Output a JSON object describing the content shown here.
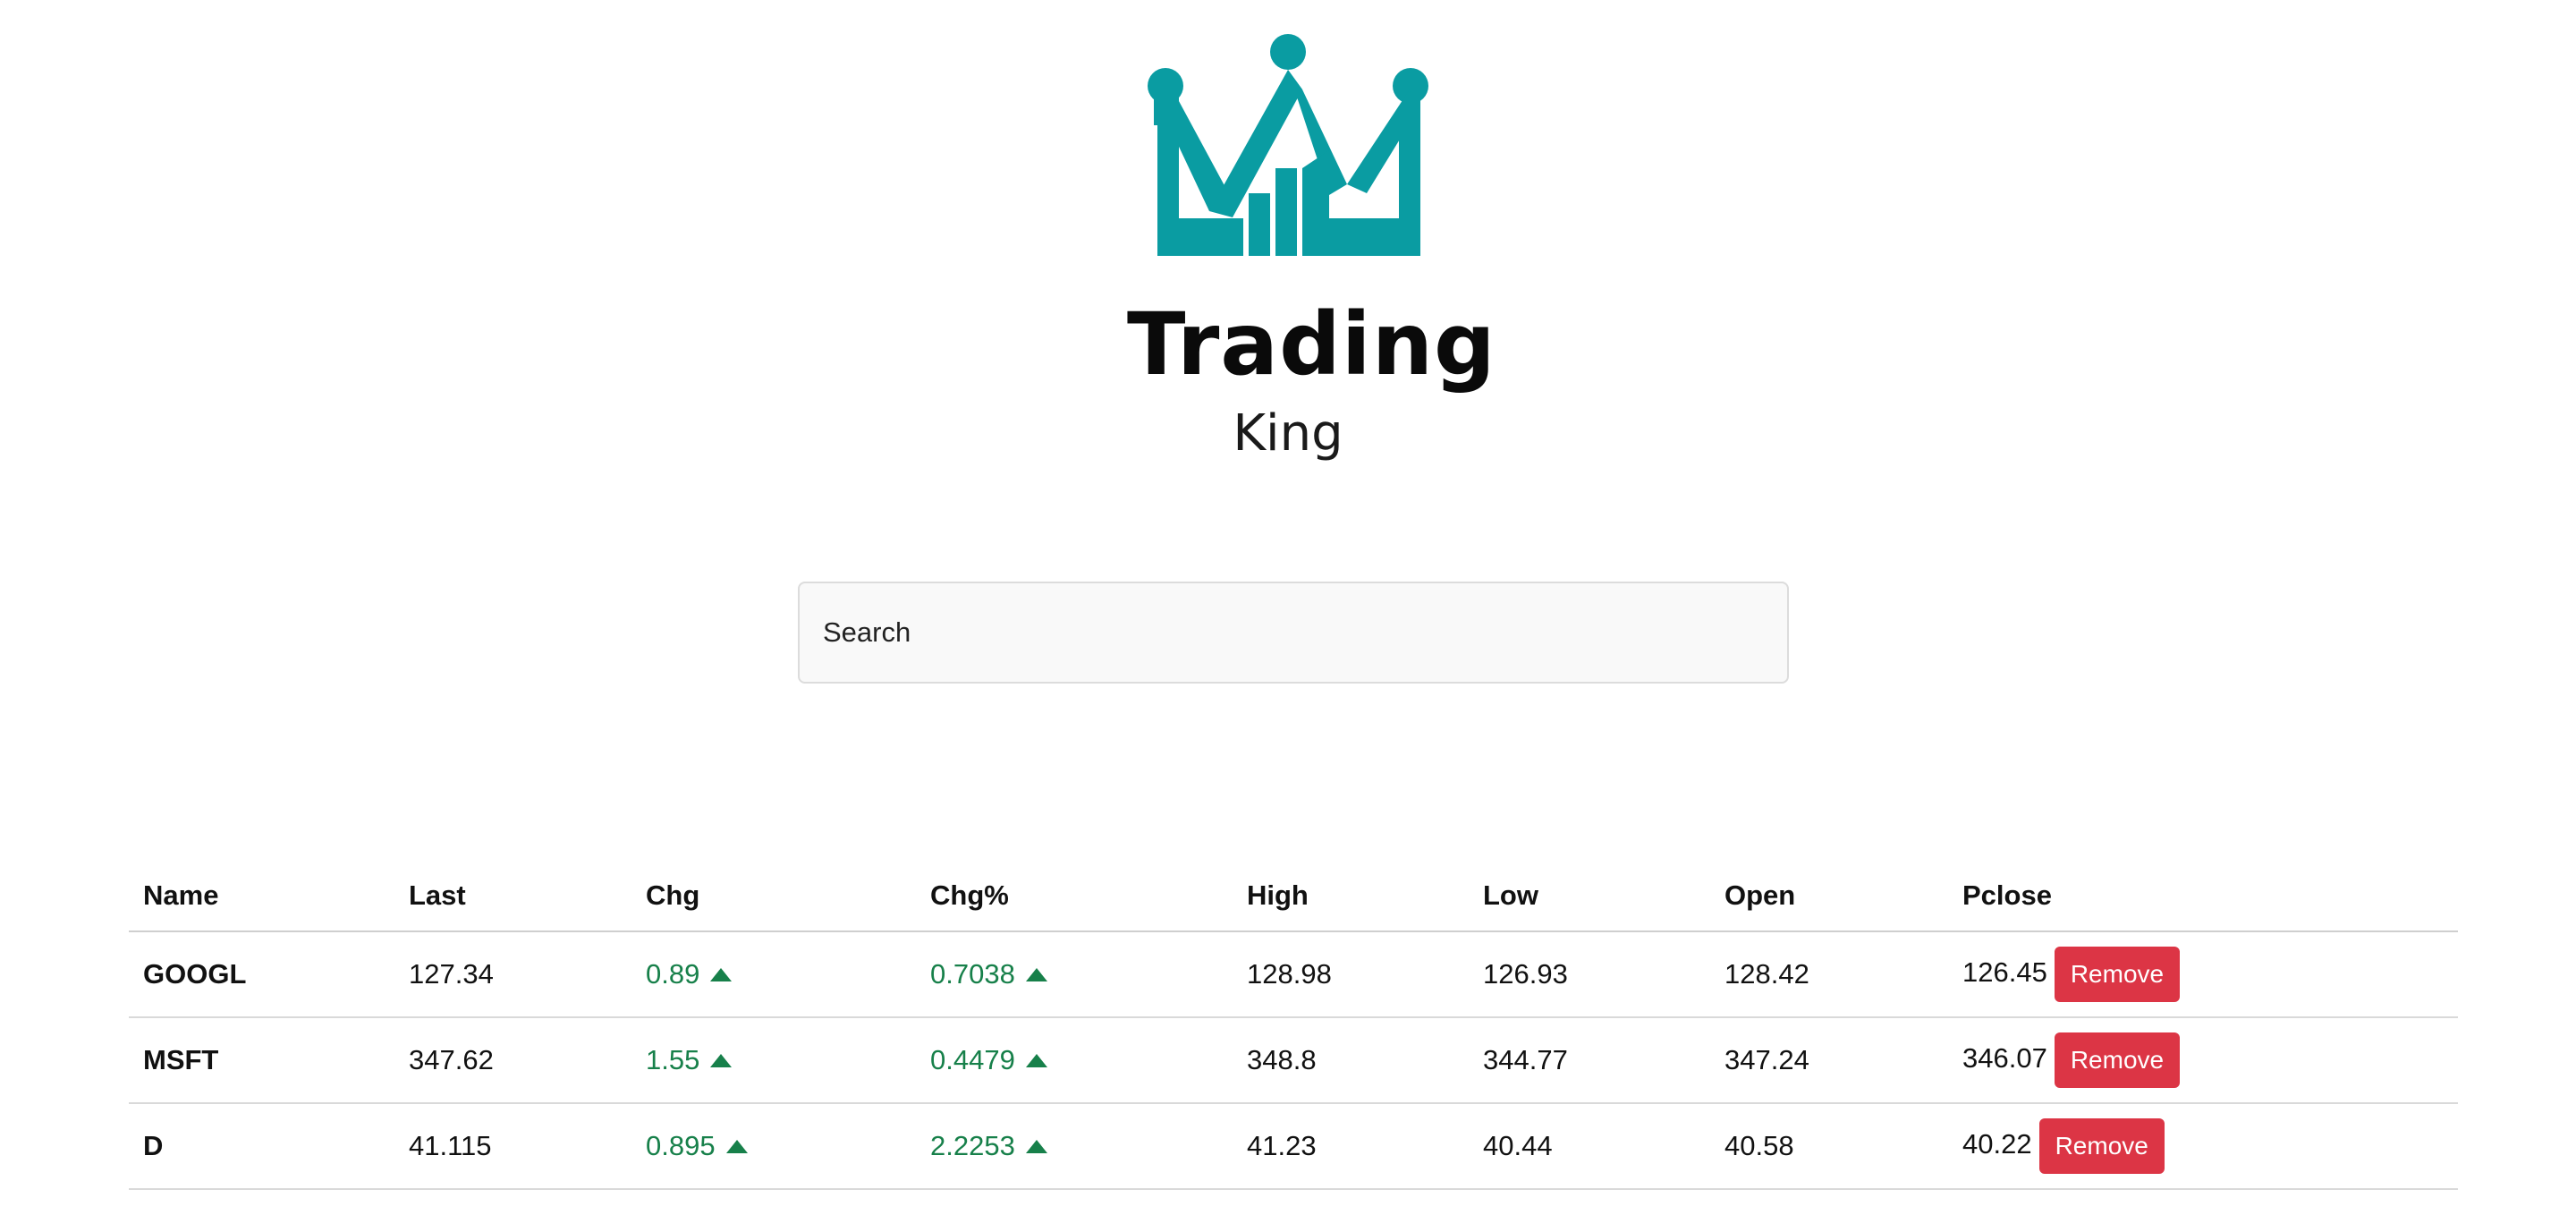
{
  "brand": {
    "title": "Trading",
    "subtitle": "King",
    "color": "#0a9ca2"
  },
  "search": {
    "placeholder": "Search",
    "value": ""
  },
  "table": {
    "headers": [
      "Name",
      "Last",
      "Chg",
      "Chg%",
      "High",
      "Low",
      "Open",
      "Pclose"
    ],
    "rows": [
      {
        "name": "GOOGL",
        "last": "127.34",
        "chg": "0.89",
        "chg_pct": "0.7038",
        "high": "128.98",
        "low": "126.93",
        "open": "128.42",
        "pclose": "126.45",
        "action": "Remove"
      },
      {
        "name": "MSFT",
        "last": "347.62",
        "chg": "1.55",
        "chg_pct": "0.4479",
        "high": "348.8",
        "low": "344.77",
        "open": "347.24",
        "pclose": "346.07",
        "action": "Remove"
      },
      {
        "name": "D",
        "last": "41.115",
        "chg": "0.895",
        "chg_pct": "2.2253",
        "high": "41.23",
        "low": "40.44",
        "open": "40.58",
        "pclose": "40.22",
        "action": "Remove"
      }
    ],
    "up_color": "#17804a",
    "remove_color": "#dc3545",
    "trend_icon": "triangle-up-icon"
  }
}
